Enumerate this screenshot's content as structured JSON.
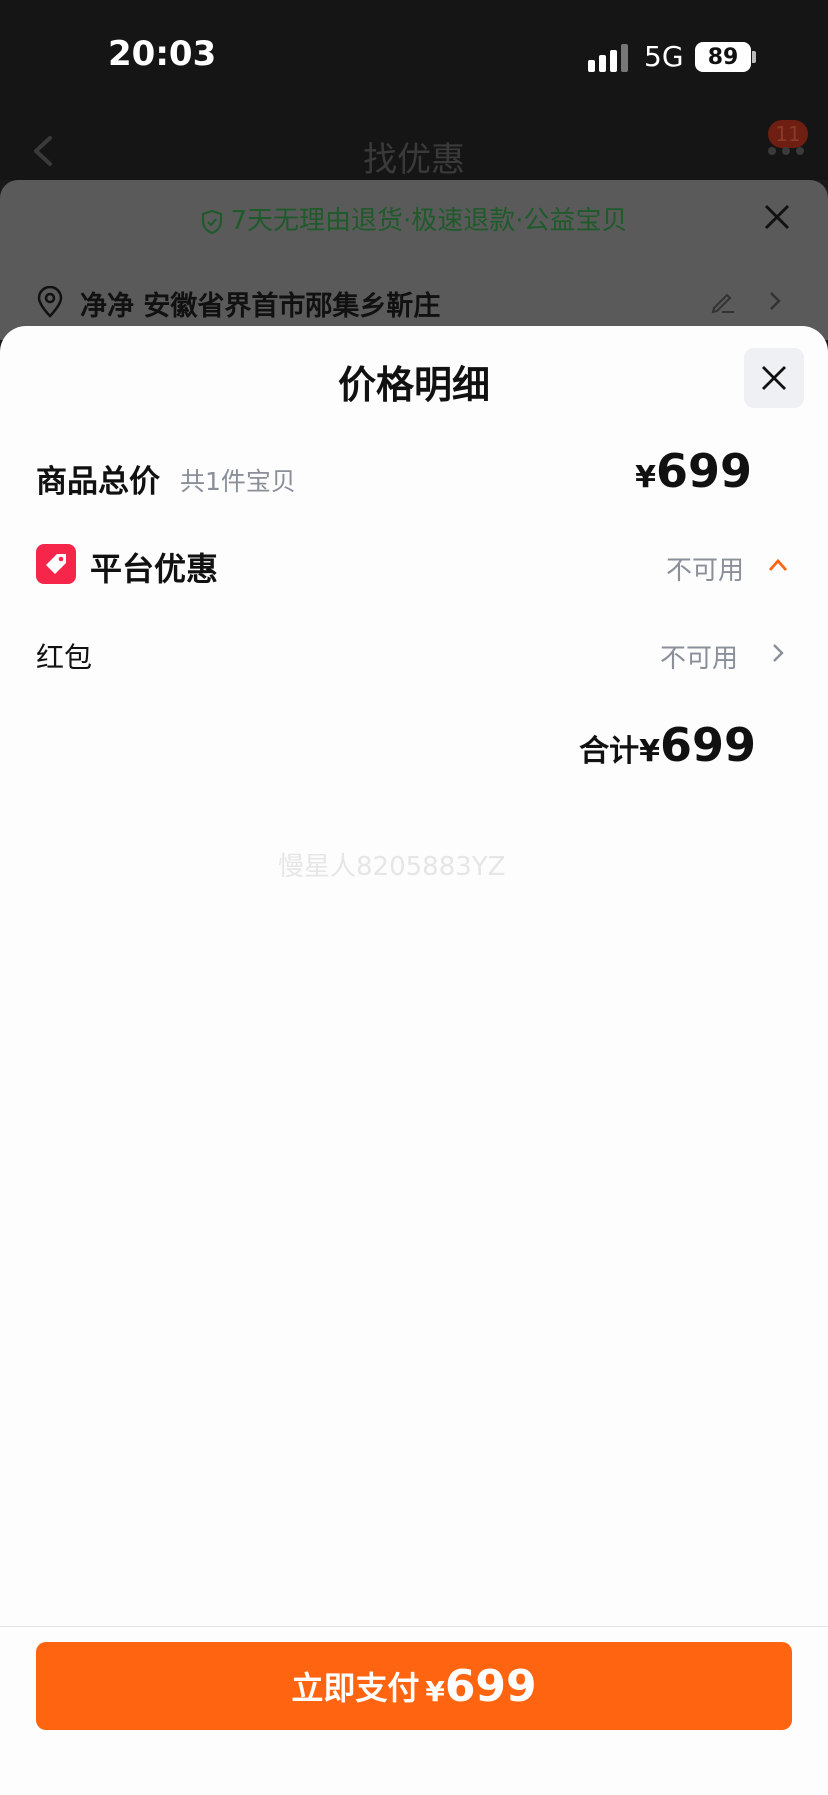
{
  "status_bar": {
    "time": "20:03",
    "network": "5G",
    "battery": "89"
  },
  "nav": {
    "title": "找优惠",
    "badge": "11"
  },
  "background_card": {
    "promise": "7天无理由退货·极速退款·公益宝贝",
    "address": "净净 安徽省界首市邴集乡靳庄"
  },
  "sheet": {
    "title": "价格明细",
    "total_label": "商品总价",
    "total_sub": "共1件宝贝",
    "currency": "¥",
    "total_price": "699",
    "platform_label": "平台优惠",
    "platform_status": "不可用",
    "redpacket_label": "红包",
    "redpacket_status": "不可用",
    "sum_label": "合计",
    "sum_price": "699",
    "watermark": "慢星人8205883YZ"
  },
  "footer": {
    "pay_label": "立即支付",
    "pay_price": "699"
  },
  "colors": {
    "accent": "#ff6410",
    "promo_tag": "#f5264a",
    "muted_text": "#8a8f99"
  }
}
